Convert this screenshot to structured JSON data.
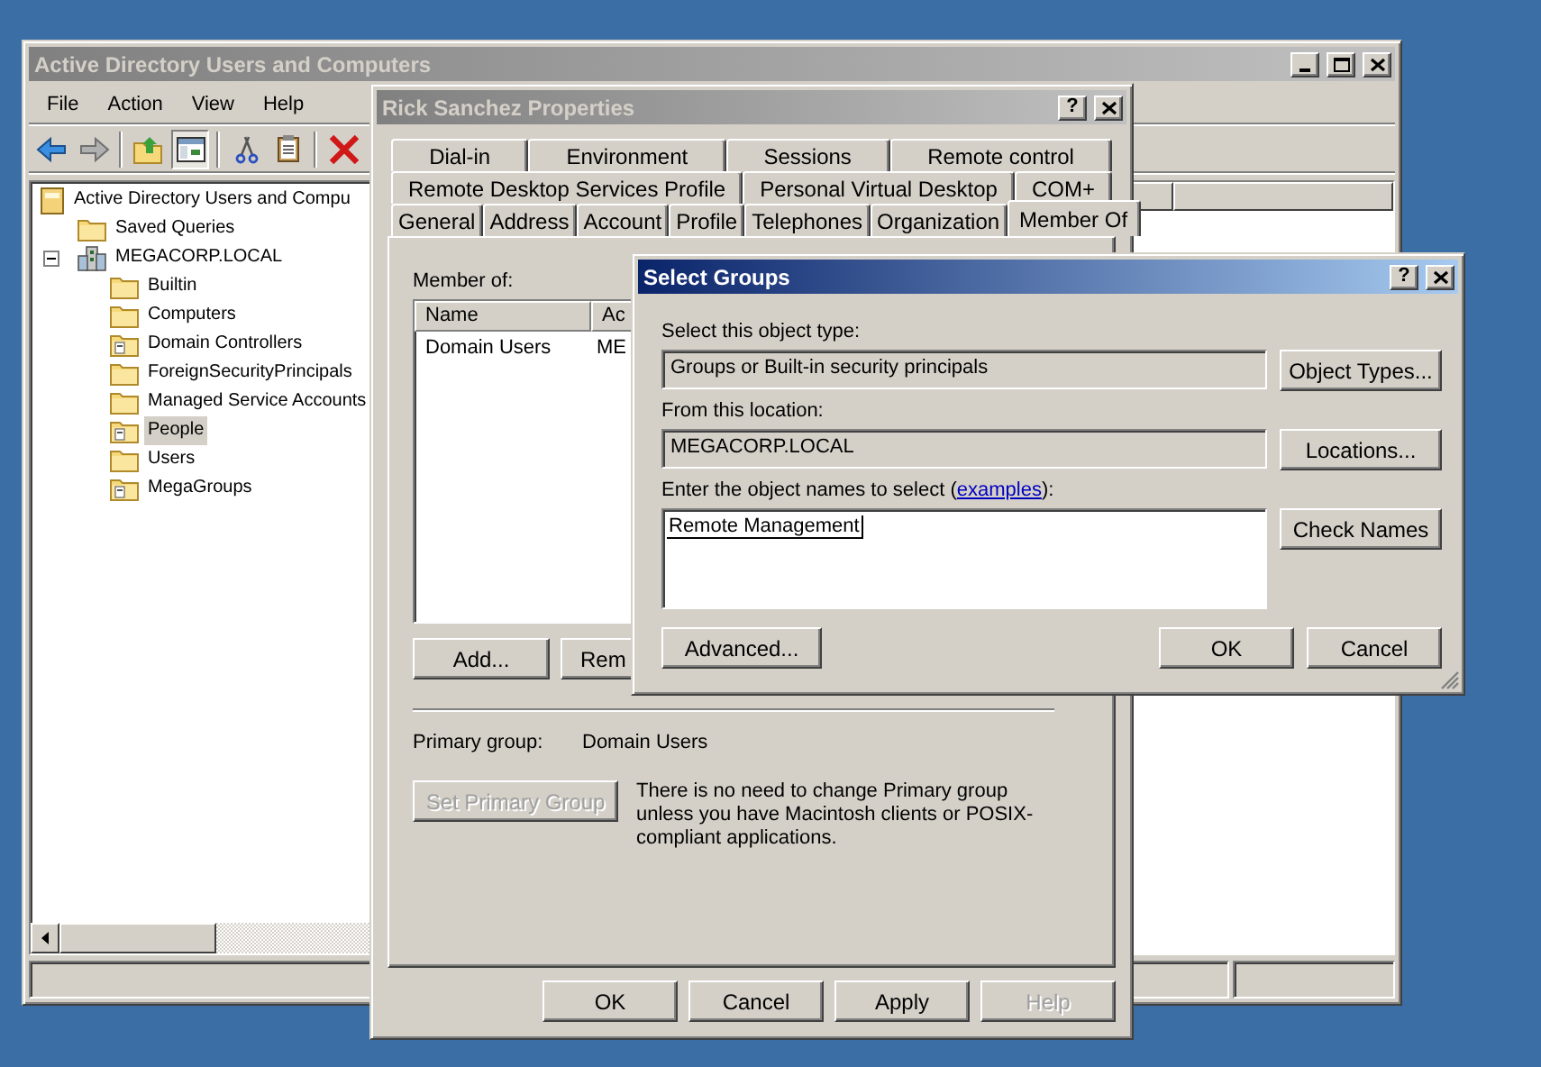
{
  "main_window": {
    "title": "Active Directory Users and Computers",
    "active": false,
    "menu": [
      "File",
      "Action",
      "View",
      "Help"
    ],
    "tree": {
      "label": "Active Directory Users and Compu",
      "kind": "root",
      "selected": false,
      "children": [
        {
          "label": "Saved Queries",
          "kind": "folder",
          "selected": false
        },
        {
          "label": "MEGACORP.LOCAL",
          "kind": "domain",
          "selected": false,
          "expanded": true,
          "children": [
            {
              "label": "Builtin",
              "kind": "folder",
              "selected": false
            },
            {
              "label": "Computers",
              "kind": "folder",
              "selected": false
            },
            {
              "label": "Domain Controllers",
              "kind": "ou",
              "selected": false
            },
            {
              "label": "ForeignSecurityPrincipals",
              "kind": "folder",
              "selected": false
            },
            {
              "label": "Managed Service Accounts",
              "kind": "folder",
              "selected": false
            },
            {
              "label": "People",
              "kind": "ou",
              "selected": true
            },
            {
              "label": "Users",
              "kind": "folder",
              "selected": false
            },
            {
              "label": "MegaGroups",
              "kind": "ou",
              "selected": false
            }
          ]
        }
      ]
    }
  },
  "properties": {
    "title": "Rick Sanchez Properties",
    "active": false,
    "help_button": "?",
    "tab_rows": [
      {
        "tabs": [
          {
            "label": "Dial-in",
            "selected": false
          },
          {
            "label": "Environment",
            "selected": false
          },
          {
            "label": "Sessions",
            "selected": false
          },
          {
            "label": "Remote control",
            "selected": false
          }
        ]
      },
      {
        "tabs": [
          {
            "label": "Remote Desktop Services Profile",
            "selected": false
          },
          {
            "label": "Personal Virtual Desktop",
            "selected": false
          },
          {
            "label": "COM+",
            "selected": false
          }
        ]
      },
      {
        "tabs": [
          {
            "label": "General",
            "selected": false
          },
          {
            "label": "Address",
            "selected": false
          },
          {
            "label": "Account",
            "selected": false
          },
          {
            "label": "Profile",
            "selected": false
          },
          {
            "label": "Telephones",
            "selected": false
          },
          {
            "label": "Organization",
            "selected": false
          },
          {
            "label": "Member Of",
            "selected": true
          }
        ]
      }
    ],
    "member_of_label": "Member of:",
    "columns": [
      "Name",
      "Ac"
    ],
    "rows": [
      [
        "Domain Users",
        "ME"
      ]
    ],
    "add_button": "Add...",
    "remove_button": "Rem",
    "primary_group_label": "Primary group:",
    "primary_group": "Domain Users",
    "set_primary_button": {
      "label": "Set Primary Group",
      "disabled": true
    },
    "note": "There is no need to change Primary group unless you have Macintosh clients or POSIX-compliant applications.",
    "buttons": [
      {
        "label": "OK",
        "disabled": false
      },
      {
        "label": "Cancel",
        "disabled": false
      },
      {
        "label": "Apply",
        "disabled": false
      },
      {
        "label": "Help",
        "disabled": true
      }
    ]
  },
  "select_groups": {
    "title": "Select Groups",
    "active": true,
    "help_button": "?",
    "object_type_label": "Select this object type:",
    "object_type": "Groups or Built-in security principals",
    "object_types_button": "Object Types...",
    "location_label": "From this location:",
    "location": "MEGACORP.LOCAL",
    "locations_button": "Locations...",
    "names_label_before": "Enter the object names to select (",
    "names_link": "examples",
    "names_label_after": "):",
    "names_value": "Remote Management",
    "check_names_button": "Check Names",
    "advanced_button": "Advanced...",
    "buttons": [
      "OK",
      "Cancel"
    ]
  }
}
